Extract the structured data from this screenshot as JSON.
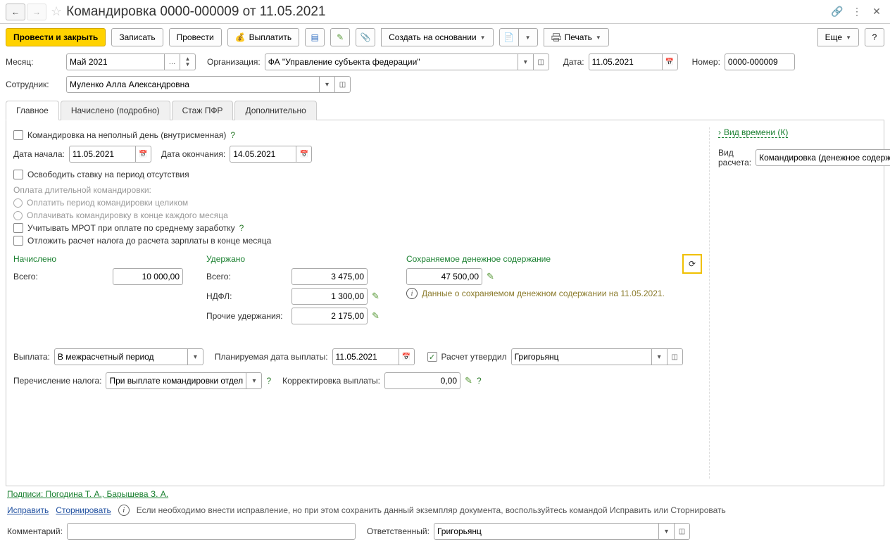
{
  "titlebar": {
    "title": "Командировка 0000-000009 от 11.05.2021"
  },
  "toolbar": {
    "post_close": "Провести и закрыть",
    "save": "Записать",
    "post": "Провести",
    "pay": "Выплатить",
    "create_based": "Создать на основании",
    "print": "Печать",
    "more": "Еще"
  },
  "header": {
    "month_label": "Месяц:",
    "month_value": "Май 2021",
    "org_label": "Организация:",
    "org_value": "ФА \"Управление субъекта федерации\"",
    "date_label": "Дата:",
    "date_value": "11.05.2021",
    "number_label": "Номер:",
    "number_value": "0000-000009",
    "employee_label": "Сотрудник:",
    "employee_value": "Муленко Алла Александровна"
  },
  "tabs": [
    "Главное",
    "Начислено (подробно)",
    "Стаж ПФР",
    "Дополнительно"
  ],
  "main": {
    "partial_day": "Командировка на неполный день (внутрисменная)",
    "start_date_label": "Дата начала:",
    "start_date": "11.05.2021",
    "end_date_label": "Дата окончания:",
    "end_date": "14.05.2021",
    "release_rate": "Освободить ставку на период отсутствия",
    "long_trip_label": "Оплата длительной командировки:",
    "pay_full": "Оплатить период командировки целиком",
    "pay_monthly": "Оплачивать командировку в конце каждого месяца",
    "mrot": "Учитывать МРОТ при оплате по среднему заработку",
    "defer_tax": "Отложить расчет налога до расчета зарплаты в конце месяца",
    "accrued_h": "Начислено",
    "total_label": "Всего:",
    "accrued_total": "10 000,00",
    "withheld_h": "Удержано",
    "withheld_total": "3 475,00",
    "ndfl_label": "НДФЛ:",
    "ndfl": "1 300,00",
    "other_label": "Прочие удержания:",
    "other": "2 175,00",
    "kept_h": "Сохраняемое денежное содержание",
    "kept_amount": "47 500,00",
    "kept_info": "Данные о сохраняемом денежном содержании на 11.05.2021.",
    "payment_label": "Выплата:",
    "payment_value": "В межрасчетный период",
    "plan_date_label": "Планируемая дата выплаты:",
    "plan_date": "11.05.2021",
    "approved_label": "Расчет утвердил",
    "approver": "Григорьянц",
    "tax_transfer_label": "Перечисление налога:",
    "tax_transfer_value": "При выплате командировки отдел",
    "correction_label": "Корректировка выплаты:",
    "correction": "0,00"
  },
  "side": {
    "time_type": "Вид времени (К)",
    "calc_type_label": "Вид расчета:",
    "calc_type_value": "Командировка (денежное содержание)"
  },
  "footer": {
    "signatures": "Подписи: Погодина Т. А., Барышева З. А.",
    "fix": "Исправить",
    "storno": "Сторнировать",
    "fix_hint": "Если необходимо внести исправление, но при этом сохранить данный экземпляр документа, воспользуйтесь командой Исправить или Сторнировать",
    "comment_label": "Комментарий:",
    "resp_label": "Ответственный:",
    "resp_value": "Григорьянц"
  }
}
